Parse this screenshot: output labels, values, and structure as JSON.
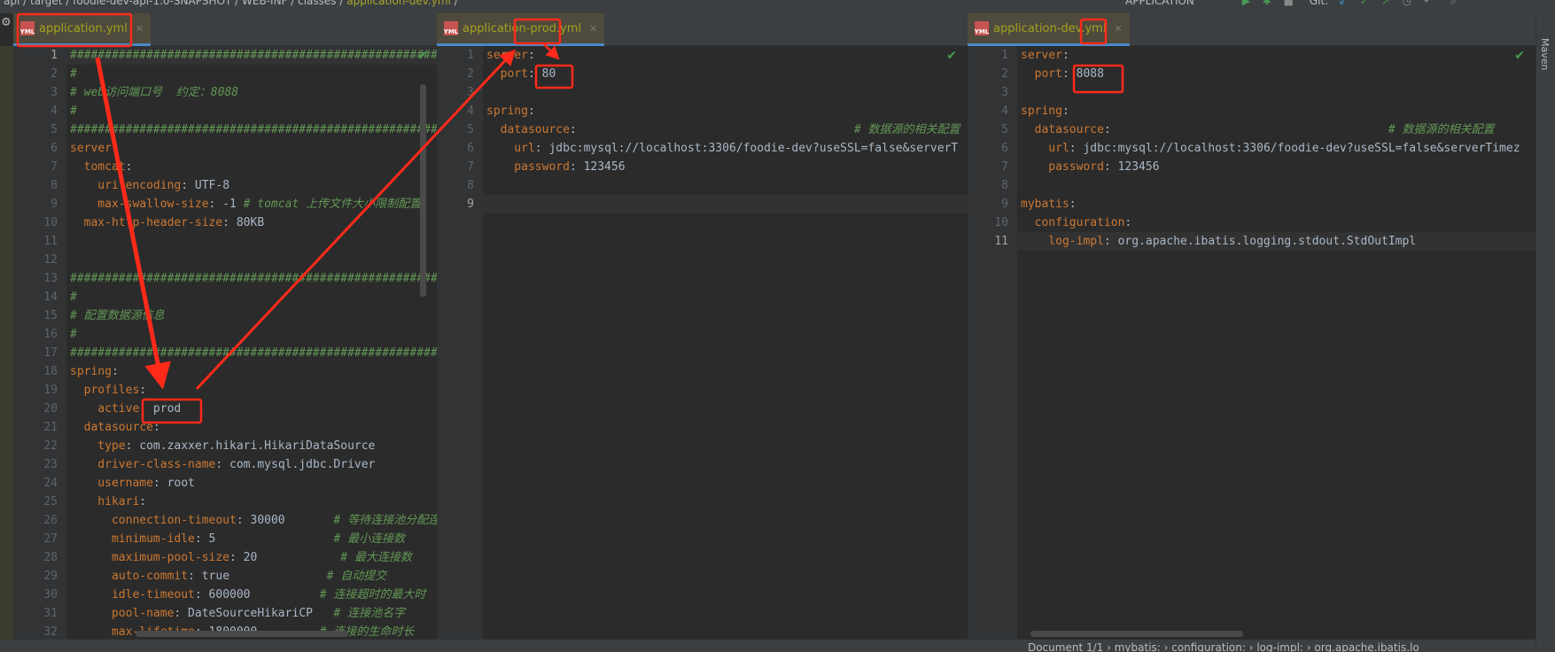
{
  "breadcrumb": {
    "items": [
      "api",
      "target",
      "foodie-dev-api-1.0-SNAPSHOT",
      "WEB-INF",
      "classes"
    ],
    "file": "application-dev.yml"
  },
  "toolbar": {
    "run_config": "APPLICATION",
    "vcs": "Git:"
  },
  "sidebar_right": {
    "maven_label": "Maven"
  },
  "status_bar": {
    "path": "Document 1/1  ›  mybatis:  ›  configuration:  ›  log-impl:  ›  org.apache.ibatis.lo"
  },
  "colors": {
    "key": "#cc7832",
    "value": "#a9b7c6",
    "comment": "#629755",
    "annotation": "#ff2a1a",
    "tab_text": "#a3a31e"
  },
  "panels": [
    {
      "tab": "application.yml",
      "file_icon": "YML",
      "current_line": 1,
      "lines": [
        [
          [
            "c",
            "##########################################################################"
          ]
        ],
        [
          [
            "c",
            "#"
          ]
        ],
        [
          [
            "c",
            "# web访问端口号  约定：8088"
          ]
        ],
        [
          [
            "c",
            "#"
          ]
        ],
        [
          [
            "c",
            "##########################################################################"
          ]
        ],
        [
          [
            "k",
            "server"
          ],
          [
            "v",
            ":"
          ]
        ],
        [
          [
            "k",
            "  tomcat"
          ],
          [
            "v",
            ":"
          ]
        ],
        [
          [
            "k",
            "    uri-encoding"
          ],
          [
            "v",
            ": UTF-8"
          ]
        ],
        [
          [
            "k",
            "    max-swallow-size"
          ],
          [
            "v",
            ": -1 "
          ],
          [
            "c",
            "# tomcat 上传文件大小限制配置"
          ]
        ],
        [
          [
            "k",
            "  max-http-header-size"
          ],
          [
            "v",
            ": 80KB"
          ]
        ],
        [],
        [],
        [
          [
            "c",
            "##########################################################################"
          ]
        ],
        [
          [
            "c",
            "#"
          ]
        ],
        [
          [
            "c",
            "# 配置数据源信息"
          ]
        ],
        [
          [
            "c",
            "#"
          ]
        ],
        [
          [
            "c",
            "##########################################################################"
          ]
        ],
        [
          [
            "k",
            "spring"
          ],
          [
            "v",
            ":"
          ]
        ],
        [
          [
            "k",
            "  profiles"
          ],
          [
            "v",
            ":"
          ]
        ],
        [
          [
            "k",
            "    active"
          ],
          [
            "v",
            ": prod"
          ]
        ],
        [
          [
            "k",
            "  datasource"
          ],
          [
            "v",
            ":"
          ]
        ],
        [
          [
            "k",
            "    type"
          ],
          [
            "v",
            ": com.zaxxer.hikari.HikariDataSource"
          ]
        ],
        [
          [
            "k",
            "    driver-class-name"
          ],
          [
            "v",
            ": com.mysql.jdbc.Driver"
          ]
        ],
        [
          [
            "k",
            "    username"
          ],
          [
            "v",
            ": root"
          ]
        ],
        [
          [
            "k",
            "    hikari"
          ],
          [
            "v",
            ":"
          ]
        ],
        [
          [
            "k",
            "      connection-timeout"
          ],
          [
            "v",
            ": 30000       "
          ],
          [
            "c",
            "# 等待连接池分配连"
          ]
        ],
        [
          [
            "k",
            "      minimum-idle"
          ],
          [
            "v",
            ": 5                 "
          ],
          [
            "c",
            "# 最小连接数"
          ]
        ],
        [
          [
            "k",
            "      maximum-pool-size"
          ],
          [
            "v",
            ": 20            "
          ],
          [
            "c",
            "# 最大连接数"
          ]
        ],
        [
          [
            "k",
            "      auto-commit"
          ],
          [
            "v",
            ": true              "
          ],
          [
            "c",
            "# 自动提交"
          ]
        ],
        [
          [
            "k",
            "      idle-timeout"
          ],
          [
            "v",
            ": 600000          "
          ],
          [
            "c",
            "# 连接超时的最大时"
          ]
        ],
        [
          [
            "k",
            "      pool-name"
          ],
          [
            "v",
            ": DateSourceHikariCP   "
          ],
          [
            "c",
            "# 连接池名字"
          ]
        ],
        [
          [
            "k",
            "      max-lifetime"
          ],
          [
            "v",
            ": 1800000         "
          ],
          [
            "c",
            "# 连接的生命时长"
          ]
        ]
      ]
    },
    {
      "tab": "application-prod.yml",
      "file_icon": "YML",
      "current_line": 9,
      "lines": [
        [
          [
            "k",
            "server"
          ],
          [
            "v",
            ":"
          ]
        ],
        [
          [
            "k",
            "  port"
          ],
          [
            "v",
            ": 80"
          ]
        ],
        [],
        [
          [
            "k",
            "spring"
          ],
          [
            "v",
            ":"
          ]
        ],
        [
          [
            "k",
            "  datasource"
          ],
          [
            "v",
            ":                                        "
          ],
          [
            "c",
            "# 数据源的相关配置"
          ]
        ],
        [
          [
            "k",
            "    url"
          ],
          [
            "v",
            ": jdbc:mysql://localhost:3306/foodie-dev?useSSL=false&serverT"
          ]
        ],
        [
          [
            "k",
            "    password"
          ],
          [
            "v",
            ": 123456"
          ]
        ],
        [],
        []
      ]
    },
    {
      "tab": "application-dev.yml",
      "file_icon": "YML",
      "current_line": 11,
      "lines": [
        [
          [
            "k",
            "server"
          ],
          [
            "v",
            ":"
          ]
        ],
        [
          [
            "k",
            "  port"
          ],
          [
            "v",
            ": 8088"
          ]
        ],
        [],
        [
          [
            "k",
            "spring"
          ],
          [
            "v",
            ":"
          ]
        ],
        [
          [
            "k",
            "  datasource"
          ],
          [
            "v",
            ":                                        "
          ],
          [
            "c",
            "# 数据源的相关配置"
          ]
        ],
        [
          [
            "k",
            "    url"
          ],
          [
            "v",
            ": jdbc:mysql://localhost:3306/foodie-dev?useSSL=false&serverTimez"
          ]
        ],
        [
          [
            "k",
            "    password"
          ],
          [
            "v",
            ": 123456"
          ]
        ],
        [],
        [
          [
            "k",
            "mybatis"
          ],
          [
            "v",
            ":"
          ]
        ],
        [
          [
            "k",
            "  configuration"
          ],
          [
            "v",
            ":"
          ]
        ],
        [
          [
            "k",
            "    log-impl"
          ],
          [
            "v",
            ": org.apache.ibatis.logging.stdout.StdOutImpl"
          ]
        ]
      ]
    }
  ]
}
